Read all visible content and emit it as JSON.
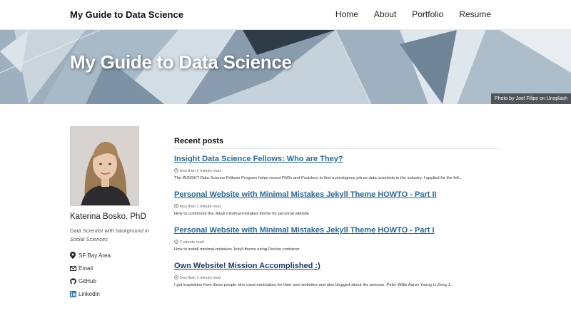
{
  "masthead": {
    "site_title": "My Guide to Data Science",
    "nav": [
      "Home",
      "About",
      "Portfolio",
      "Resume"
    ]
  },
  "hero": {
    "title": "My Guide to Data Science",
    "caption": "Photo by Joel Filipe on Unsplash"
  },
  "author": {
    "name": "Katerina Bosko, PhD",
    "bio": "Data Scientist with background in Social Sciences",
    "links": [
      {
        "icon": "location-pin-icon",
        "label": "SF Bay Area"
      },
      {
        "icon": "email-icon",
        "label": "Email"
      },
      {
        "icon": "github-icon",
        "label": "GitHub"
      },
      {
        "icon": "linkedin-icon",
        "label": "Linkedin"
      }
    ]
  },
  "recent_posts": {
    "heading": "Recent posts",
    "items": [
      {
        "title": "Insight Data Science Fellows: Who are They?",
        "read_time": "less than 1 minute read",
        "excerpt": "The INSIGHT Data Science Fellows Program helps recent PhDs and Postdocs to find a prestigious job as data scientists in the industry. I applied for the fell..."
      },
      {
        "title": "Personal Website with Minimal Mistakes Jekyll Theme HOWTO - Part II",
        "read_time": "less than 1 minute read",
        "excerpt": "How to customize the Jekyll minimal-mistakes theme for personal website"
      },
      {
        "title": "Personal Website with Minimal Mistakes Jekyll Theme HOWTO - Part I",
        "read_time": "2 minute read",
        "excerpt": "How to install minimal-mistakes Jekyll theme using Docker container"
      },
      {
        "title": "Own Website! Mission Accomplished :)",
        "read_time": "less than 1 minute read",
        "excerpt": "I got inspiration from these people who used mmistakes for their own websites and also blogged about the process: Peter Willis Aaron Young Li Zeng J..."
      }
    ]
  },
  "colors": {
    "link": "#2b6a9a",
    "link_visited": "#1d3a6b",
    "linkedin": "#2e77b3"
  }
}
